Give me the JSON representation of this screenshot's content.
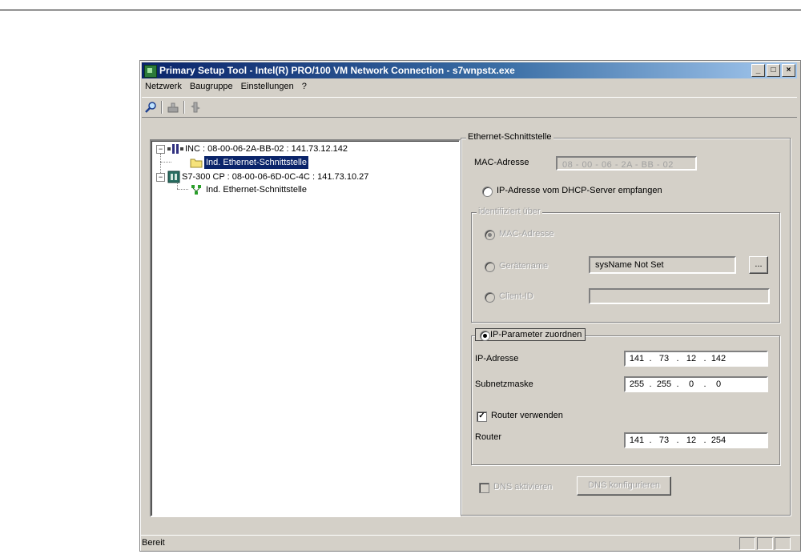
{
  "window": {
    "title": "Primary Setup Tool - Intel(R) PRO/100 VM Network Connection - s7wnpstx.exe",
    "controls": {
      "minimize": "_",
      "maximize": "□",
      "close": "×"
    }
  },
  "menu": [
    "Netzwerk",
    "Baugruppe",
    "Einstellungen",
    "?"
  ],
  "toolbar": {
    "icons": [
      "magnifier-icon",
      "load-icon",
      "transfer-icon"
    ]
  },
  "tree": {
    "nodes": [
      {
        "label": "INC : 08-00-06-2A-BB-02 : 141.73.12.142",
        "expander": "−"
      },
      {
        "label": "Ind. Ethernet-Schnittstelle",
        "selected": true
      },
      {
        "label": "S7-300 CP : 08-00-06-6D-0C-4C : 141.73.10.27",
        "expander": "−"
      },
      {
        "label": "Ind. Ethernet-Schnittstelle"
      }
    ]
  },
  "ethernet": {
    "group_title": "Ethernet-Schnittstelle",
    "mac_label": "MAC-Adresse",
    "mac_value": "08 - 00 - 06 - 2A - BB - 02",
    "dhcp_label": "IP-Adresse vom DHCP-Server empfangen",
    "identify": {
      "title": "identifiziert über",
      "mac_option": "MAC-Adresse",
      "device_name_option": "Gerätename",
      "device_name_value": "sysName Not Set",
      "browse_label": "...",
      "client_id_option": "Client-ID",
      "client_id_value": ""
    },
    "ip_params": {
      "title": "IP-Parameter zuordnen",
      "ip_label": "IP-Adresse",
      "ip_value": [
        "141",
        "73",
        "12",
        "142"
      ],
      "subnet_label": "Subnetzmaske",
      "subnet_value": [
        "255",
        "255",
        "0",
        "0"
      ],
      "use_router_label": "Router verwenden",
      "router_label": "Router",
      "router_value": [
        "141",
        "73",
        "12",
        "254"
      ]
    },
    "dns_activate_label": "DNS aktivieren",
    "dns_configure_label": "DNS konfigurieren"
  },
  "status": {
    "text": "Bereit"
  }
}
